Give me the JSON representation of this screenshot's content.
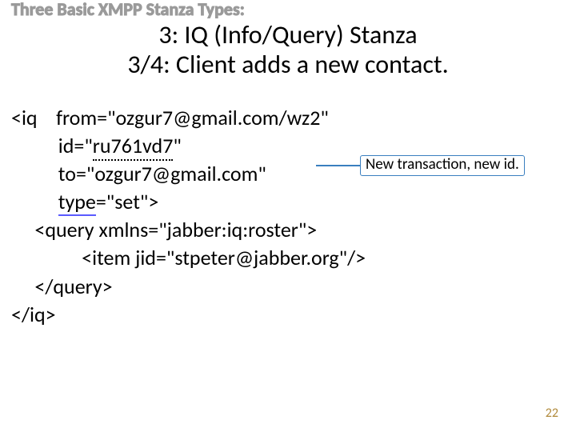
{
  "header": {
    "outline_title": "Three Basic XMPP Stanza Types:",
    "title_line1": "3: IQ (Info/Query) Stanza",
    "title_line2": "3/4: Client adds a new contact."
  },
  "code": {
    "l1_tag": "<iq    ",
    "l1_attr": "from",
    "l1_val": "=\"ozgur7@gmail.com/wz2\"",
    "l2_pad": "          ",
    "l2_attr": "id",
    "l2_eq": "=\"",
    "l2_val_underlined": "ru761vd7",
    "l2_val_tail": "\"",
    "l3_pad": "          ",
    "l3_attr": "to",
    "l3_val": "=\"ozgur7@gmail.com\"",
    "l4_pad": "          ",
    "l4_attr_u": "type",
    "l4_val": "=\"set\">",
    "l5": "     <query ",
    "l5_attr": "xmlns",
    "l5_val": "=\"jabber:iq:roster\">",
    "l6": "               <item ",
    "l6_attr": "jid",
    "l6_val": "=\"stpeter@jabber.org\"/>",
    "l7": "     </query>",
    "l8": "</iq>"
  },
  "callout": {
    "text": "New transaction, new id."
  },
  "footer": {
    "page_number": "22"
  }
}
